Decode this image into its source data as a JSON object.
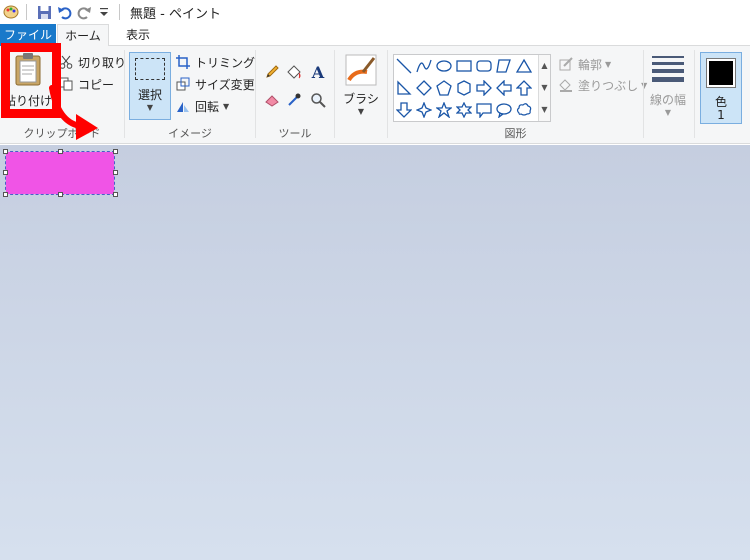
{
  "window": {
    "title": "無題 - ペイント"
  },
  "tabs": {
    "file": "ファイル",
    "home": "ホーム",
    "view": "表示"
  },
  "clipboard": {
    "paste": "貼り付け",
    "cut": "切り取り",
    "copy": "コピー",
    "group_label": "クリップボード"
  },
  "image": {
    "select": "選択",
    "crop": "トリミング",
    "resize": "サイズ変更",
    "rotate": "回転",
    "group_label": "イメージ"
  },
  "tools": {
    "group_label": "ツール"
  },
  "brushes": {
    "label": "ブラシ"
  },
  "shapes": {
    "outline": "輪郭",
    "fill": "塗りつぶし",
    "group_label": "図形"
  },
  "size": {
    "label": "線の幅"
  },
  "color": {
    "label": "色",
    "number": "1",
    "value": "#000000"
  },
  "canvas": {
    "selection_fill": "#f054e6"
  },
  "accent": {
    "file_tab": "#1979ca",
    "annotation": "#ff0000"
  }
}
